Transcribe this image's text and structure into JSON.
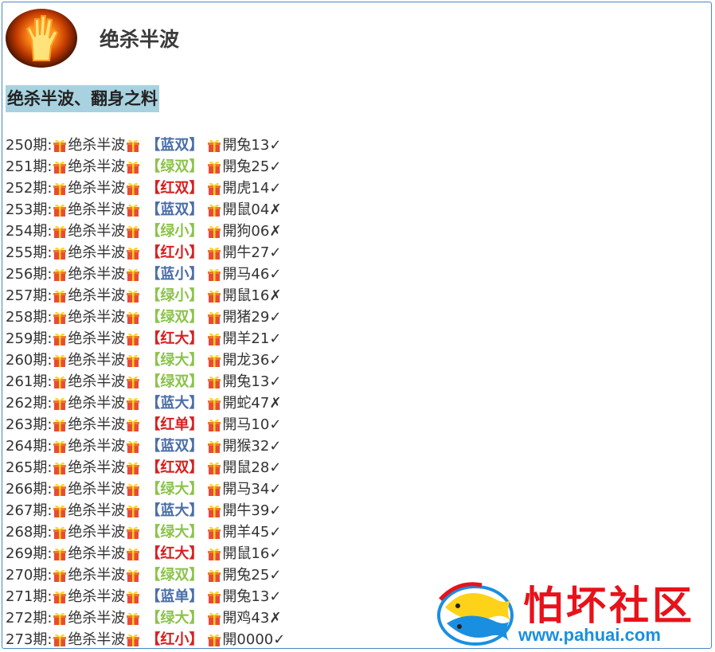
{
  "header": {
    "title": "绝杀半波"
  },
  "subtitle": "绝杀半波、翻身之料",
  "colors": {
    "蓝": "#4a6ea8",
    "绿": "#8bc34a",
    "红": "#d62020"
  },
  "rows": [
    {
      "period": "250期:",
      "text": "绝杀半波",
      "label": "【蓝双】",
      "color": "蓝",
      "result": "開兔13✓"
    },
    {
      "period": "251期:",
      "text": "绝杀半波",
      "label": "【绿双】",
      "color": "绿",
      "result": "開兔25✓"
    },
    {
      "period": "252期:",
      "text": "绝杀半波",
      "label": "【红双】",
      "color": "红",
      "result": "開虎14✓"
    },
    {
      "period": "253期:",
      "text": "绝杀半波",
      "label": "【蓝双】",
      "color": "蓝",
      "result": "開鼠04✗"
    },
    {
      "period": "254期:",
      "text": "绝杀半波",
      "label": "【绿小】",
      "color": "绿",
      "result": "開狗06✗"
    },
    {
      "period": "255期:",
      "text": "绝杀半波",
      "label": "【红小】",
      "color": "红",
      "result": "開牛27✓"
    },
    {
      "period": "256期:",
      "text": "绝杀半波",
      "label": "【蓝小】",
      "color": "蓝",
      "result": "開马46✓"
    },
    {
      "period": "257期:",
      "text": "绝杀半波",
      "label": "【绿小】",
      "color": "绿",
      "result": "開鼠16✗"
    },
    {
      "period": "258期:",
      "text": "绝杀半波",
      "label": "【绿双】",
      "color": "绿",
      "result": "開猪29✓"
    },
    {
      "period": "259期:",
      "text": "绝杀半波",
      "label": "【红大】",
      "color": "红",
      "result": "開羊21✓"
    },
    {
      "period": "260期:",
      "text": "绝杀半波",
      "label": "【绿大】",
      "color": "绿",
      "result": "開龙36✓"
    },
    {
      "period": "261期:",
      "text": "绝杀半波",
      "label": "【绿双】",
      "color": "绿",
      "result": "開兔13✓"
    },
    {
      "period": "262期:",
      "text": "绝杀半波",
      "label": "【蓝大】",
      "color": "蓝",
      "result": "開蛇47✗"
    },
    {
      "period": "263期:",
      "text": "绝杀半波",
      "label": "【红单】",
      "color": "红",
      "result": "開马10✓"
    },
    {
      "period": "264期:",
      "text": "绝杀半波",
      "label": "【蓝双】",
      "color": "蓝",
      "result": "開猴32✓"
    },
    {
      "period": "265期:",
      "text": "绝杀半波",
      "label": "【红双】",
      "color": "红",
      "result": "開鼠28✓"
    },
    {
      "period": "266期:",
      "text": "绝杀半波",
      "label": "【绿大】",
      "color": "绿",
      "result": "開马34✓"
    },
    {
      "period": "267期:",
      "text": "绝杀半波",
      "label": "【蓝大】",
      "color": "蓝",
      "result": "開牛39✓"
    },
    {
      "period": "268期:",
      "text": "绝杀半波",
      "label": "【绿大】",
      "color": "绿",
      "result": "開羊45✓"
    },
    {
      "period": "269期:",
      "text": "绝杀半波",
      "label": "【红大】",
      "color": "红",
      "result": "開鼠16✓"
    },
    {
      "period": "270期:",
      "text": "绝杀半波",
      "label": "【绿双】",
      "color": "绿",
      "result": "開兔25✓"
    },
    {
      "period": "271期:",
      "text": "绝杀半波",
      "label": "【蓝单】",
      "color": "蓝",
      "result": "開兔13✓"
    },
    {
      "period": "272期:",
      "text": "绝杀半波",
      "label": "【绿大】",
      "color": "绿",
      "result": "開鸡43✗"
    },
    {
      "period": "273期:",
      "text": "绝杀半波",
      "label": "【红小】",
      "color": "红",
      "result": "開0000✓"
    }
  ],
  "watermark": {
    "name": "怕坏社区",
    "url": "www.pahuai.com"
  }
}
